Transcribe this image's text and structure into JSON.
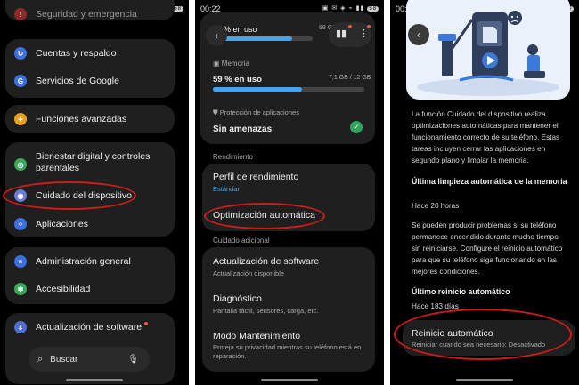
{
  "status": {
    "time": "00:22",
    "icons": "▣ ✉ ◈ ⌁ ▮▮",
    "battery": "58"
  },
  "screen1": {
    "top_item": "Seguridad y emergencia",
    "items": [
      {
        "label": "Cuentas y respaldo",
        "icon": "sync-icon",
        "color": "#3d6fe0",
        "glyph": "↻"
      },
      {
        "label": "Servicios de Google",
        "icon": "google-icon",
        "color": "#3d6fe0",
        "glyph": "G"
      },
      {
        "label": "Funciones avanzadas",
        "icon": "star-icon",
        "color": "#e8a21a",
        "glyph": "✦"
      },
      {
        "label": "Bienestar digital y controles parentales",
        "icon": "wellbeing-icon",
        "color": "#3aa85a",
        "glyph": "◎"
      },
      {
        "label": "Cuidado del dispositivo",
        "icon": "device-care-icon",
        "color": "#6b7bd6",
        "glyph": "◉"
      },
      {
        "label": "Aplicaciones",
        "icon": "apps-icon",
        "color": "#3d6fe0",
        "glyph": "⁘"
      },
      {
        "label": "Administración general",
        "icon": "sliders-icon",
        "color": "#3d6fe0",
        "glyph": "≡"
      },
      {
        "label": "Accesibilidad",
        "icon": "accessibility-icon",
        "color": "#3aa85a",
        "glyph": "✱"
      },
      {
        "label": "Actualización de software",
        "icon": "update-icon",
        "color": "#4f6fd0",
        "glyph": "⇩"
      }
    ],
    "search_placeholder": "Buscar"
  },
  "screen2": {
    "storage_usage": "% en uso",
    "storage_amount": "98 GB",
    "storage_fraction": 0.77,
    "memory_label": "Memoria",
    "memory_usage": "59 % en uso",
    "memory_amount": "7,1 GB / 12 GB",
    "memory_fraction": 0.59,
    "protection_label": "Protección de aplicaciones",
    "protection_status": "Sin amenazas",
    "section_rendimiento": "Rendimiento",
    "perfil_title": "Perfil de rendimiento",
    "perfil_value": "Estándar",
    "optimizacion_title": "Optimización automática",
    "section_cuidado": "Cuidado adicional",
    "update_title": "Actualización de software",
    "update_sub": "Actualización disponible",
    "diag_title": "Diagnóstico",
    "diag_sub": "Pantalla táctil, sensores, carga, etc.",
    "maint_title": "Modo Mantenimiento",
    "maint_sub": "Proteja su privacidad mientras su teléfono está en reparación."
  },
  "screen3": {
    "description": "La función Cuidado del dispositivo realiza optimizaciones automáticas para mantener el funcionamiento correcto de su teléfono. Estas tareas incluyen cerrar las aplicaciones en segundo plano y limpiar la memoria.",
    "last_clean_title": "Última limpieza automática de la memoria",
    "last_clean_value": "Hace 20 horas",
    "restart_note": "Se pueden producir problemas si su teléfono permanece encendido durante mucho tiempo sin reiniciarse. Configure el reinicio automático para que su teléfono siga funcionando en las mejores condiciones.",
    "last_restart_title": "Último reinicio automático",
    "last_restart_value": "Hace 183 días",
    "auto_restart_title": "Reinicio automático",
    "auto_restart_sub": "Reiniciar cuando sea necesario: Desactivado"
  },
  "colors": {
    "accent_blue": "#4aa3e8",
    "ring_red": "#d01b1b",
    "ok_green": "#2ea55a",
    "card_bg": "#1f1f1f"
  }
}
